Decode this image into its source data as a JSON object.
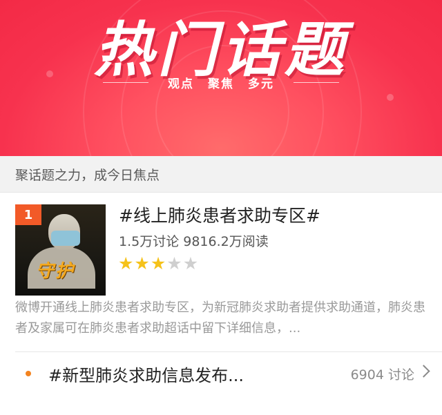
{
  "banner": {
    "title": "热门话题",
    "subtitle_words": [
      "观点",
      "聚焦",
      "多元"
    ]
  },
  "section": {
    "header": "聚话题之力，成今日焦点"
  },
  "featured_topic": {
    "rank": "1",
    "title": "#线上肺炎患者求助专区#",
    "stats": "1.5万讨论 9816.2万阅读",
    "stars_filled": 3,
    "stars_total": 5,
    "description": "微博开通线上肺炎患者求助专区，为新冠肺炎求助者提供求助通道，肺炎患者及家属可在肺炎患者求助超话中留下详细信息，...",
    "thumbnail_text": "守护",
    "icons": {
      "star": "star-icon"
    }
  },
  "topic_list": [
    {
      "title": "#新型肺炎求助信息发布...",
      "count": "6904 讨论"
    }
  ],
  "colors": {
    "banner_red": "#f32a46",
    "badge_orange": "#f25a28",
    "star_gold": "#f5c21a",
    "dot_orange": "#f3831f"
  }
}
